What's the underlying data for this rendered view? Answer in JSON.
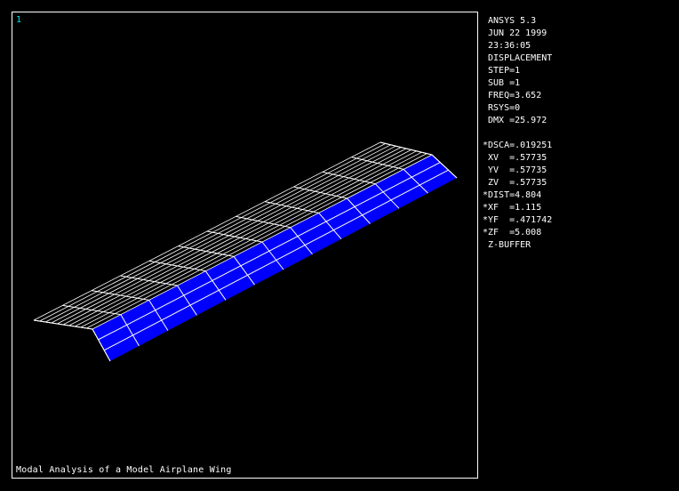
{
  "viewport": {
    "window_number": "1",
    "caption": "Modal Analysis of a Model Airplane Wing"
  },
  "info_panel": {
    "block1": [
      " ANSYS 5.3",
      " JUN 22 1999",
      " 23:36:05",
      " DISPLACEMENT",
      " STEP=1",
      " SUB =1",
      " FREQ=3.652",
      " RSYS=0",
      " DMX =25.972"
    ],
    "block2": [
      "*DSCA=.019251",
      " XV  =.57735",
      " YV  =.57735",
      " ZV  =.57735",
      "*DIST=4.804",
      "*XF  =1.115",
      "*YF  =.471742",
      "*ZF  =5.008",
      " Z-BUFFER"
    ]
  },
  "colors": {
    "background": "#000000",
    "mesh_fill": "#0000ff",
    "mesh_lines": "#ffffff",
    "window_number": "#00e5e5"
  },
  "icons": [
    "wing-mesh-model"
  ]
}
